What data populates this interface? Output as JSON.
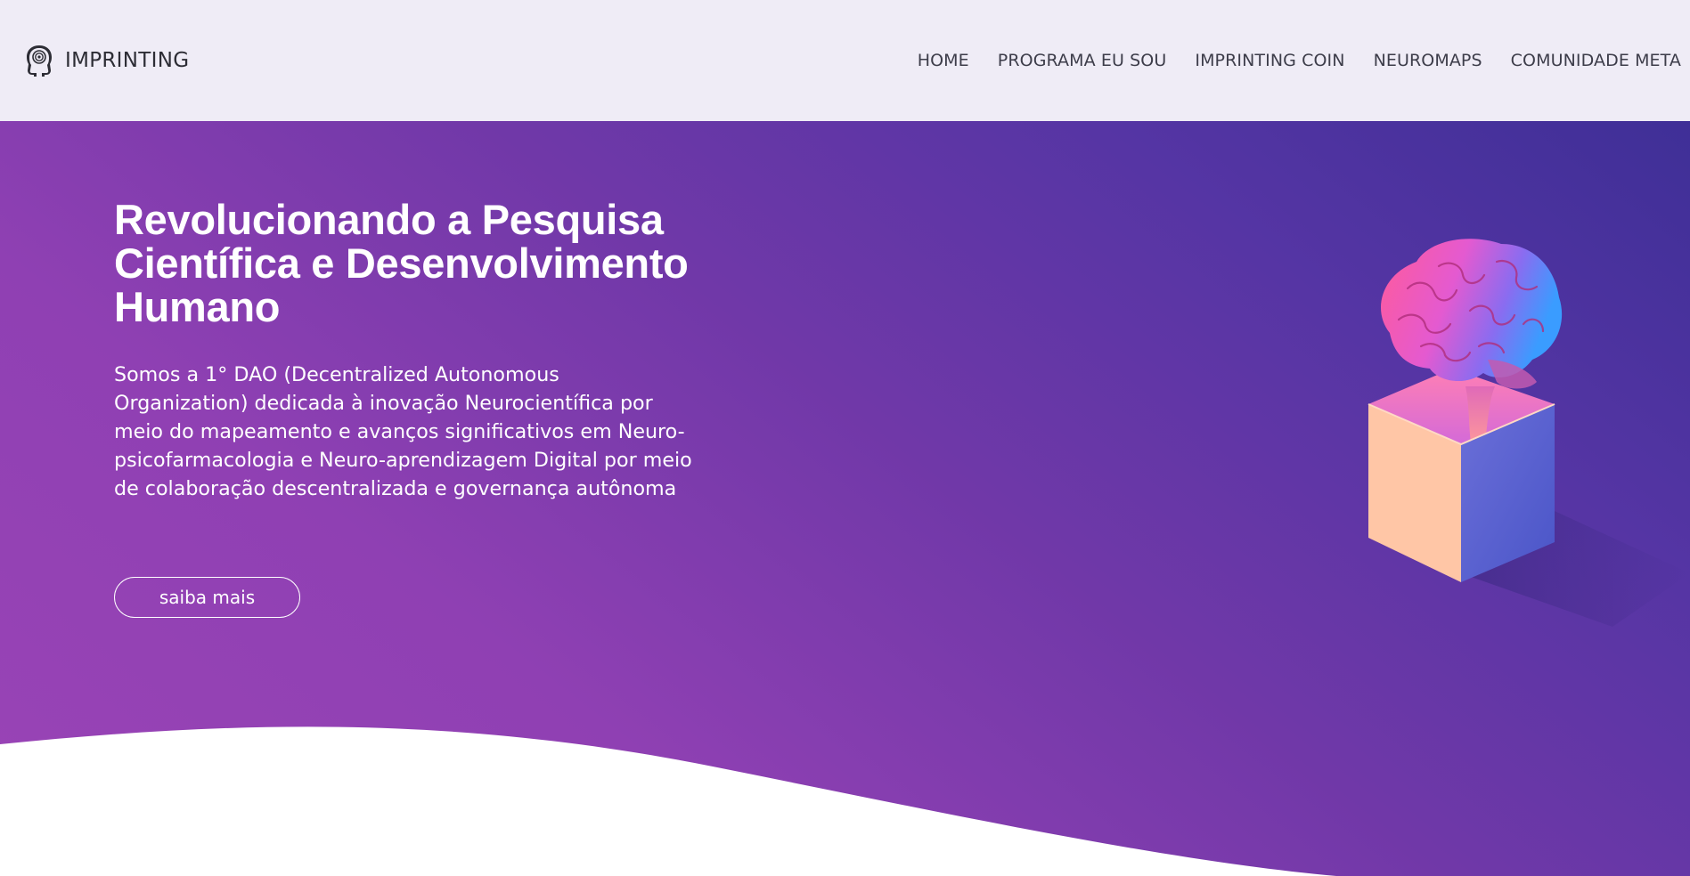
{
  "brand": {
    "name": "IMPRINTING",
    "logo_icon": "head-spiral-icon"
  },
  "nav": {
    "items": [
      {
        "label": "HOME"
      },
      {
        "label": "PROGRAMA EU SOU"
      },
      {
        "label": "IMPRINTING COIN"
      },
      {
        "label": "NEUROMAPS"
      },
      {
        "label": "COMUNIDADE META"
      }
    ]
  },
  "hero": {
    "title": "Revolucionando a Pesquisa Científica e Desenvolvimento Humano",
    "description": "Somos a 1° DAO (Decentralized Autonomous Organization) dedicada à inovação Neurocientífica por meio do mapeamento e avanços significativos em Neuro-psicofarmacologia e Neuro-aprendizagem Digital por meio de colaboração descentralizada e governança autônoma",
    "cta_label": "saiba mais",
    "illustration": "brain-in-box-illustration"
  },
  "colors": {
    "header_bg": "#efecf6",
    "hero_gradient_start": "#9a44b6",
    "hero_gradient_end": "#3f2f97",
    "text_dark": "#2d2d35",
    "text_light": "#ffffff"
  }
}
